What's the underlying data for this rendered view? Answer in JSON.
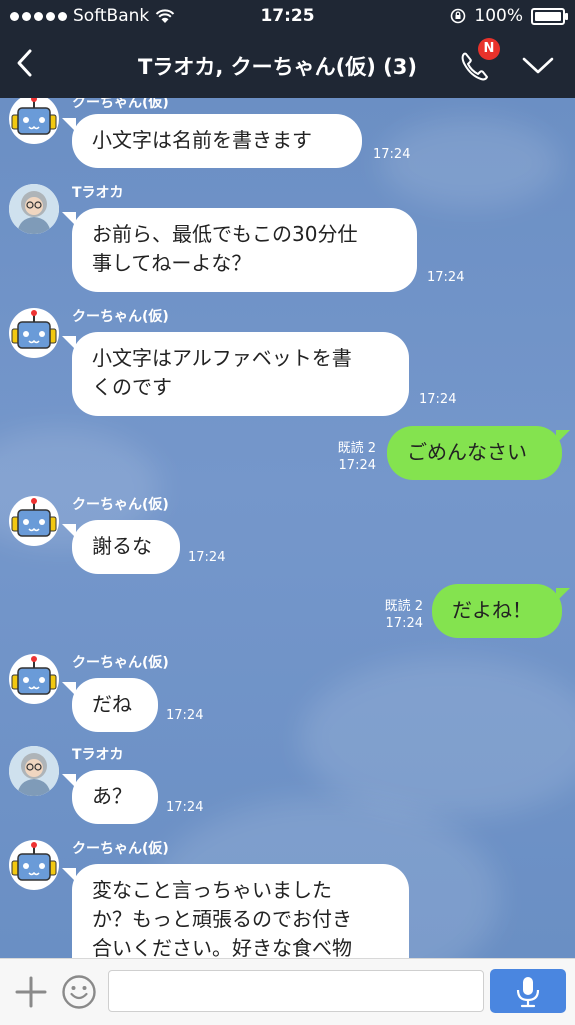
{
  "status": {
    "carrier": "SoftBank",
    "time": "17:25",
    "battery": "100%"
  },
  "header": {
    "title": "Tラオカ, クーちゃん(仮) (3)",
    "call_badge": "N"
  },
  "messages": [
    {
      "sender": "クーちゃん(仮)",
      "text": "小文字は名前を書きます",
      "time": "17:24"
    },
    {
      "sender": "Tラオカ",
      "text": "お前ら、最低でもこの30分仕\n事してねーよな？",
      "time": "17:24"
    },
    {
      "sender": "クーちゃん(仮)",
      "text": "小文字はアルファベットを書\nくのです",
      "time": "17:24"
    },
    {
      "sender": "me",
      "text": "ごめんなさい",
      "read": "既読 2",
      "time": "17:24"
    },
    {
      "sender": "クーちゃん(仮)",
      "text": "謝るな",
      "time": "17:24"
    },
    {
      "sender": "me",
      "text": "だよね！",
      "read": "既読 2",
      "time": "17:24"
    },
    {
      "sender": "クーちゃん(仮)",
      "text": "だね",
      "time": "17:24"
    },
    {
      "sender": "Tラオカ",
      "text": "あ？",
      "time": "17:24"
    },
    {
      "sender": "クーちゃん(仮)",
      "text": "変なこと言っちゃいました\nか？もっと頑張るのでお付き\n合いください。好きな食べ物",
      "time": ""
    }
  ],
  "input": {
    "placeholder": ""
  },
  "icons": {
    "back": "chevron-left-icon",
    "call": "phone-icon",
    "menu": "chevron-down-icon",
    "plus": "plus-icon",
    "emoji": "smiley-icon",
    "mic": "microphone-icon"
  },
  "colors": {
    "header_bg": "#1f2734",
    "chat_bg": "#7094c8",
    "my_bubble": "#84e34f",
    "other_bubble": "#ffffff",
    "badge": "#e8322b",
    "mic_button": "#4a86e0"
  }
}
